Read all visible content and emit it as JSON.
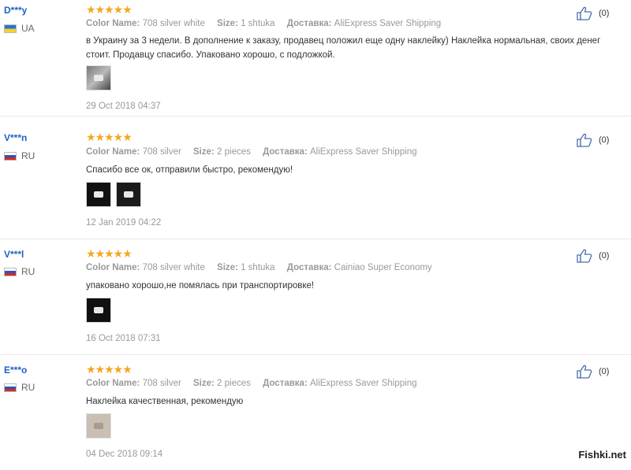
{
  "labels": {
    "color_name": "Color Name:",
    "size": "Size:",
    "delivery": "Доставка:"
  },
  "reviews": [
    {
      "user": "D***y",
      "country": "UA",
      "stars": "★★★★★",
      "color_name": "708 silver white",
      "size": "1 shtuka",
      "delivery": "AliExpress Saver Shipping",
      "text": "в Украину за 3 недели. В дополнение к заказу, продавец положил еще одну наклейку) Наклейка нормальная, своих денег стоит. Продавцу спасибо. Упаковано хорошо, с подложкой.",
      "date": "29 Oct 2018 04:37",
      "likes": "(0)"
    },
    {
      "user": "V***n",
      "country": "RU",
      "stars": "★★★★★",
      "color_name": "708 silver",
      "size": "2 pieces",
      "delivery": "AliExpress Saver Shipping",
      "text": "Спасибо все ок, отправили быстро, рекомендую!",
      "date": "12 Jan 2019 04:22",
      "likes": "(0)"
    },
    {
      "user": "V***l",
      "country": "RU",
      "stars": "★★★★★",
      "color_name": "708 silver white",
      "size": "1 shtuka",
      "delivery": "Cainiao Super Economy",
      "text": "упаковано хорошо,не помялась при транспортировке!",
      "date": "16 Oct 2018 07:31",
      "likes": "(0)"
    },
    {
      "user": "E***o",
      "country": "RU",
      "stars": "★★★★★",
      "color_name": "708 silver",
      "size": "2 pieces",
      "delivery": "AliExpress Saver Shipping",
      "text": "Наклейка качественная, рекомендую",
      "date": "04 Dec 2018 09:14",
      "likes": "(0)"
    }
  ],
  "watermark": "Fishki.net",
  "colors": {
    "username": "#1d63c6",
    "stars": "#f5a623",
    "muted": "#999999"
  }
}
